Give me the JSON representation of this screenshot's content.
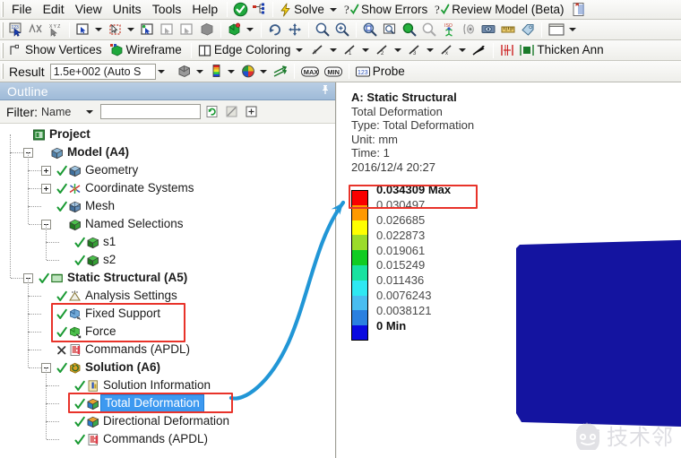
{
  "menubar": {
    "items": [
      {
        "label": "File"
      },
      {
        "label": "Edit"
      },
      {
        "label": "View"
      },
      {
        "label": "Units"
      },
      {
        "label": "Tools"
      },
      {
        "label": "Help"
      }
    ],
    "solve_label": "Solve",
    "show_errors_label": "Show Errors",
    "review_model_label": "Review Model (Beta)"
  },
  "toolbar_selection": {
    "icons": [
      "select-mode-icon",
      "extend-selection-icon",
      "select-by-id-icon",
      "single-select-icon",
      "box-select-icon",
      "vertex-filter-icon",
      "edge-filter-icon",
      "face-filter-icon",
      "body-filter-icon",
      "coordinate-system-icon",
      "rotate-icon",
      "pan-icon"
    ]
  },
  "toolbar_view": {
    "icons": [
      "zoom-icon",
      "zoom-in-icon",
      "box-zoom-icon",
      "zoom-to-fit-icon",
      "magnifier-green-icon",
      "magnifier-gray-icon",
      "iso-view-icon",
      "look-at-icon",
      "view-box-icon",
      "ruler-icon",
      "label-icon",
      "window-icon"
    ]
  },
  "toolbar_display": {
    "show_vertices_label": "Show Vertices",
    "wireframe_label": "Wireframe",
    "edge_coloring_label": "Edge Coloring",
    "thicken_label": "Thicken Ann",
    "icons": [
      "show-vertices-icon",
      "wireframe-icon",
      "edge-coloring-icon",
      "mesh-display-icon",
      "thickness-0-icon",
      "thickness-1-icon",
      "thickness-2-icon",
      "thickness-3-icon",
      "thickness-x-icon",
      "annotation-arrow-icon",
      "distance-icon",
      "thicken-icon"
    ]
  },
  "toolbar_result": {
    "result_label": "Result",
    "scale_value": "1.5e+002 (Auto S",
    "probe_label": "Probe",
    "icons": [
      "geometry-display-icon",
      "contour-bands-icon",
      "capped-iso-icon",
      "vector-display-icon",
      "max-icon",
      "min-icon",
      "probe-icon"
    ]
  },
  "outline": {
    "title": "Outline",
    "pin_icon": "pin-icon",
    "filter": {
      "label": "Filter:",
      "mode": "Name",
      "value": "",
      "placeholder": "",
      "buttons": [
        "refresh-icon",
        "clear-filter-icon",
        "expand-all-icon"
      ]
    },
    "tree": [
      {
        "label": "Project",
        "depth": 0,
        "bold": true,
        "expander": "none",
        "check": "none",
        "icon": "project-icon",
        "selected": false
      },
      {
        "label": "Model (A4)",
        "depth": 1,
        "bold": true,
        "expander": "minus",
        "check": "none",
        "icon": "model-icon",
        "selected": false
      },
      {
        "label": "Geometry",
        "depth": 2,
        "bold": false,
        "expander": "plus",
        "check": "ok",
        "icon": "geometry-icon",
        "selected": false
      },
      {
        "label": "Coordinate Systems",
        "depth": 2,
        "bold": false,
        "expander": "plus",
        "check": "ok",
        "icon": "coordsys-icon",
        "selected": false
      },
      {
        "label": "Mesh",
        "depth": 2,
        "bold": false,
        "expander": "none",
        "check": "ok",
        "icon": "mesh-icon",
        "selected": false
      },
      {
        "label": "Named Selections",
        "depth": 2,
        "bold": false,
        "expander": "minus",
        "check": "none",
        "icon": "namedsel-icon",
        "selected": false
      },
      {
        "label": "s1",
        "depth": 3,
        "bold": false,
        "expander": "none",
        "check": "ok",
        "icon": "namedsel-icon",
        "selected": false
      },
      {
        "label": "s2",
        "depth": 3,
        "bold": false,
        "expander": "none",
        "check": "ok",
        "icon": "namedsel-icon",
        "selected": false
      },
      {
        "label": "Static Structural (A5)",
        "depth": 1,
        "bold": true,
        "expander": "minus",
        "check": "ok",
        "icon": "environment-icon",
        "selected": false
      },
      {
        "label": "Analysis Settings",
        "depth": 2,
        "bold": false,
        "expander": "none",
        "check": "ok",
        "icon": "settings-icon",
        "selected": false
      },
      {
        "label": "Fixed Support",
        "depth": 2,
        "bold": false,
        "expander": "none",
        "check": "ok",
        "icon": "support-icon",
        "selected": false
      },
      {
        "label": "Force",
        "depth": 2,
        "bold": false,
        "expander": "none",
        "check": "ok",
        "icon": "load-icon",
        "selected": false
      },
      {
        "label": "Commands (APDL)",
        "depth": 2,
        "bold": false,
        "expander": "none",
        "check": "x",
        "icon": "commands-icon",
        "selected": false
      },
      {
        "label": "Solution (A6)",
        "depth": 2,
        "bold": true,
        "expander": "minus",
        "check": "ok",
        "icon": "solution-icon",
        "selected": false
      },
      {
        "label": "Solution Information",
        "depth": 3,
        "bold": false,
        "expander": "none",
        "check": "ok",
        "icon": "solinfo-icon",
        "selected": false
      },
      {
        "label": "Total Deformation",
        "depth": 3,
        "bold": false,
        "expander": "none",
        "check": "ok",
        "icon": "deformation-icon",
        "selected": true
      },
      {
        "label": "Directional Deformation",
        "depth": 3,
        "bold": false,
        "expander": "none",
        "check": "ok",
        "icon": "deformation-icon",
        "selected": false
      },
      {
        "label": "Commands (APDL)",
        "depth": 3,
        "bold": false,
        "expander": "none",
        "check": "ok",
        "icon": "commands-icon",
        "selected": false
      }
    ]
  },
  "viewport": {
    "result_info": {
      "line1": "A: Static Structural",
      "line2": "Total Deformation",
      "line3": "Type: Total Deformation",
      "line4": "Unit: mm",
      "line5": "Time: 1",
      "line6": "2016/12/4 20:27"
    },
    "legend": {
      "rows": [
        {
          "value": "0.034309 Max",
          "color": "#fa0000",
          "strong": true
        },
        {
          "value": "0.030497",
          "color": "#ff9900",
          "strong": false
        },
        {
          "value": "0.026685",
          "color": "#ffff00",
          "strong": false
        },
        {
          "value": "0.022873",
          "color": "#9bdb2a",
          "strong": false
        },
        {
          "value": "0.019061",
          "color": "#11cc22",
          "strong": false
        },
        {
          "value": "0.015249",
          "color": "#18e2a0",
          "strong": false
        },
        {
          "value": "0.011436",
          "color": "#2ee8f2",
          "strong": false
        },
        {
          "value": "0.0076243",
          "color": "#49bdf0",
          "strong": false
        },
        {
          "value": "0.0038121",
          "color": "#2a80e0",
          "strong": false
        },
        {
          "value": "0 Min",
          "color": "#0a0ae0",
          "strong": true
        }
      ]
    },
    "model": {
      "name": "deformed-part",
      "color": "#1414a0"
    }
  },
  "annotations": {
    "highlight_color": "#e8332a",
    "arrow_color": "#2196d6",
    "boxes": [
      {
        "name": "boundary-conditions-highlight"
      },
      {
        "name": "total-deformation-highlight"
      },
      {
        "name": "legend-max-highlight"
      }
    ]
  },
  "watermark": {
    "text": "技术邻",
    "icon": "face-logo-icon"
  }
}
